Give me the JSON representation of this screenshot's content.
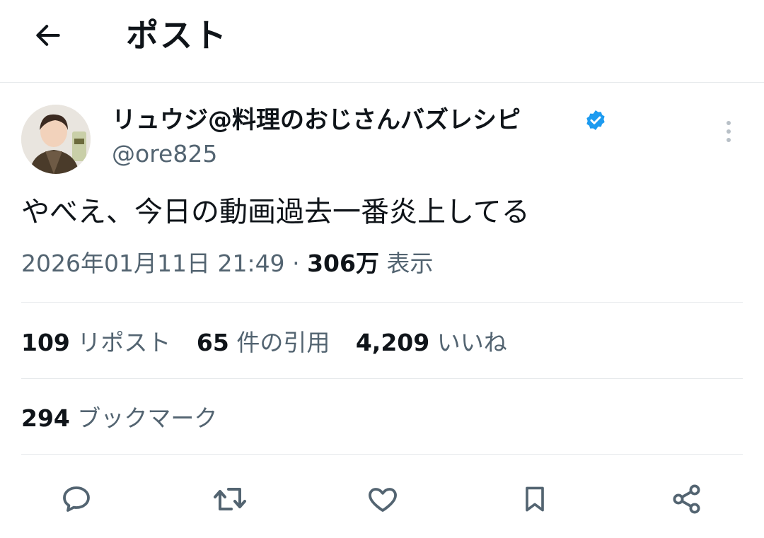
{
  "header": {
    "title": "ポスト",
    "back_icon": "arrow-left-icon"
  },
  "author": {
    "display_name": "リュウジ@料理のおじさんバズレシピ",
    "handle": "@ore825",
    "verified": true,
    "verified_color": "#1d9bf0"
  },
  "post": {
    "text": "やべえ、今日の動画過去一番炎上してる",
    "timestamp": "2026年01月11日 21:49",
    "separator": "·",
    "views_count": "306万",
    "views_label": "表示"
  },
  "stats": {
    "reposts_count": "109",
    "reposts_label": "リポスト",
    "quotes_count": "65",
    "quotes_label": "件の引用",
    "likes_count": "4,209",
    "likes_label": "いいね",
    "bookmarks_count": "294",
    "bookmarks_label": "ブックマーク"
  },
  "actions": [
    "reply-icon",
    "repost-icon",
    "like-icon",
    "bookmark-icon",
    "share-icon"
  ],
  "colors": {
    "text": "#0f1419",
    "secondary": "#536471",
    "divider": "#e6e9eb",
    "icon": "#536471"
  }
}
